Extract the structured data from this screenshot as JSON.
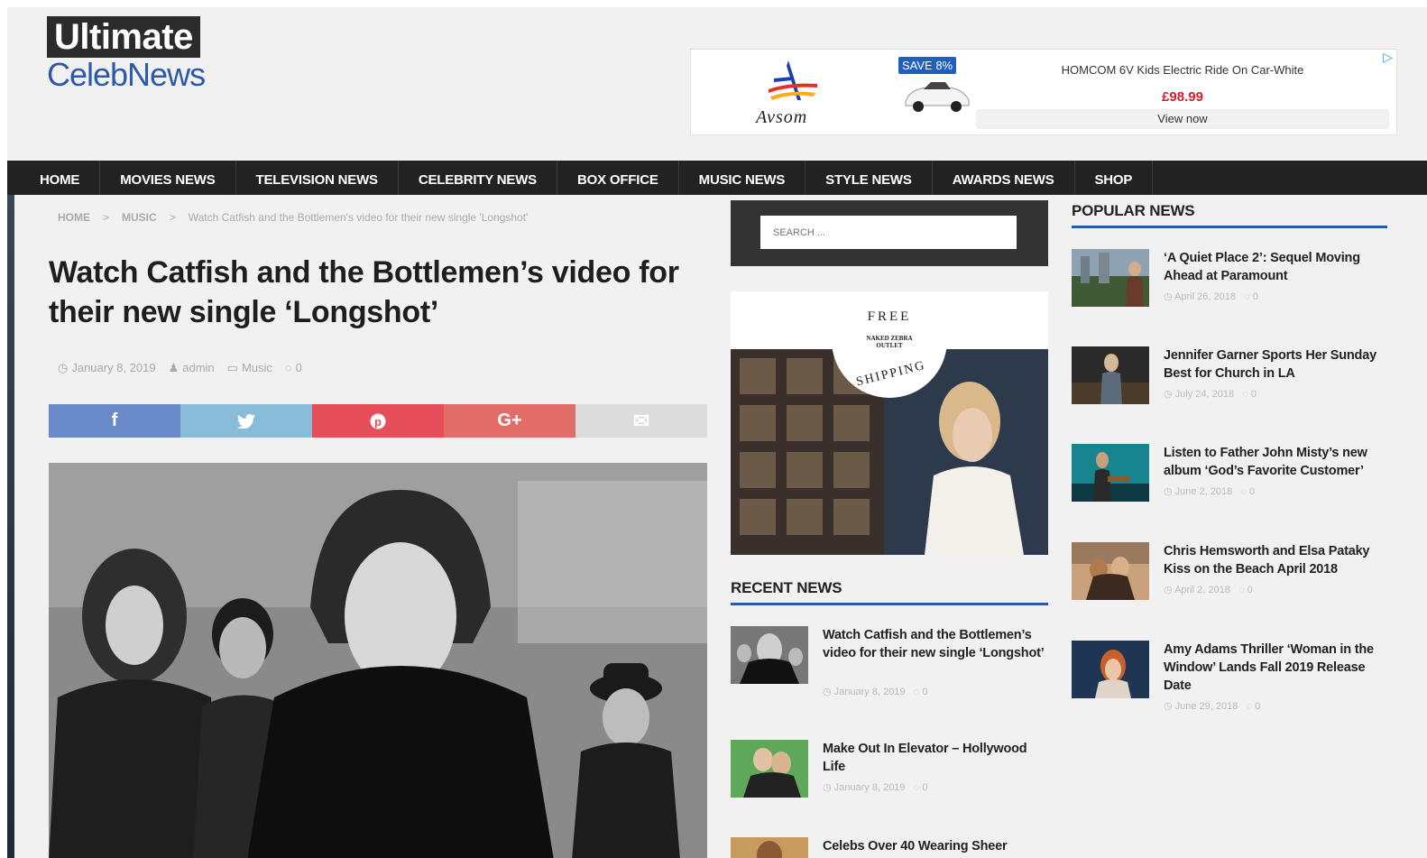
{
  "logo": {
    "top": "Ultimate",
    "bottom": "CelebNews"
  },
  "ad": {
    "brand": "Avsom",
    "badge": "SAVE 8%",
    "title": "HOMCOM 6V Kids Electric Ride On Car-White",
    "price": "£98.99",
    "cta": "View now",
    "choice_icon": "adchoices-icon"
  },
  "nav": {
    "items": [
      "HOME",
      "MOVIES NEWS",
      "TELEVISION NEWS",
      "CELEBRITY NEWS",
      "BOX OFFICE",
      "MUSIC NEWS",
      "STYLE NEWS",
      "AWARDS NEWS",
      "SHOP"
    ]
  },
  "breadcrumb": {
    "home": "HOME",
    "section": "MUSIC",
    "current": "Watch Catfish and the Bottlemen's video for their new single 'Longshot'",
    "separator": ">"
  },
  "article": {
    "title": "Watch Catfish and the Bottlemen’s video for their new single ‘Longshot’",
    "date": "January 8, 2019",
    "author": "admin",
    "category": "Music",
    "comments": "0"
  },
  "share": {
    "facebook": "f",
    "twitter": "t",
    "pinterest": "p",
    "googleplus": "G+",
    "email": "✉"
  },
  "search": {
    "placeholder": "SEARCH ..."
  },
  "promo": {
    "free": "FREE",
    "shipping": "SHIPPING",
    "seal": "NAKED ZEBRA OUTLET"
  },
  "recent": {
    "heading": "RECENT NEWS",
    "items": [
      {
        "title": "Watch Catfish and the Bottlemen’s video for their new single ‘Longshot’",
        "date": "January 8, 2019",
        "comments": "0"
      },
      {
        "title": "Make Out In Elevator – Hollywood Life",
        "date": "January 8, 2019",
        "comments": "0"
      },
      {
        "title": "Celebs Over 40 Wearing Sheer",
        "date": "",
        "comments": ""
      }
    ]
  },
  "popular": {
    "heading": "POPULAR NEWS",
    "items": [
      {
        "title": "‘A Quiet Place 2’: Sequel Moving Ahead at Paramount",
        "date": "April 26, 2018",
        "comments": "0"
      },
      {
        "title": "Jennifer Garner Sports Her Sunday Best for Church in LA",
        "date": "July 24, 2018",
        "comments": "0"
      },
      {
        "title": "Listen to Father John Misty’s new album ‘God’s Favorite Customer’",
        "date": "June 2, 2018",
        "comments": "0"
      },
      {
        "title": "Chris Hemsworth and Elsa Pataky Kiss on the Beach April 2018",
        "date": "April 2, 2018",
        "comments": "0"
      },
      {
        "title": "Amy Adams Thriller ‘Woman in the Window’ Lands Fall 2019 Release Date",
        "date": "June 29, 2018",
        "comments": "0"
      }
    ]
  },
  "colors": {
    "accent": "#2d5aa8",
    "nav_bg": "#222222",
    "facebook": "#6a8ac9",
    "twitter": "#88bcd9",
    "pinterest": "#e64f5a",
    "googleplus": "#e06e66"
  }
}
